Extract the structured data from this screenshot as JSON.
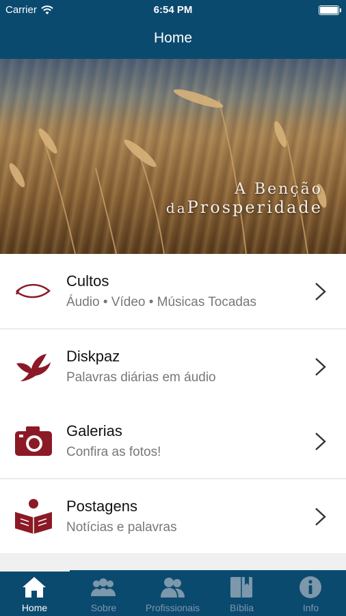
{
  "status_bar": {
    "carrier": "Carrier",
    "time": "6:54 PM"
  },
  "navbar": {
    "title": "Home"
  },
  "banner": {
    "line1": "A Benção",
    "line2_prefix": "da",
    "line2_main": "Prosperidade"
  },
  "menu": [
    {
      "title": "Cultos",
      "subtitle": "Áudio • Vídeo • Músicas Tocadas",
      "icon": "fish-icon"
    },
    {
      "title": "Diskpaz",
      "subtitle": "Palavras diárias em áudio",
      "icon": "dove-icon"
    },
    {
      "title": "Galerias",
      "subtitle": "Confira as fotos!",
      "icon": "camera-icon"
    },
    {
      "title": "Postagens",
      "subtitle": "Notícias e palavras",
      "icon": "reader-icon"
    }
  ],
  "tabs": [
    {
      "label": "Home",
      "icon": "home-icon",
      "active": true
    },
    {
      "label": "Sobre",
      "icon": "group-icon",
      "active": false
    },
    {
      "label": "Profissionais",
      "icon": "people-icon",
      "active": false
    },
    {
      "label": "Bíblia",
      "icon": "book-icon",
      "active": false
    },
    {
      "label": "Info",
      "icon": "info-icon",
      "active": false
    }
  ],
  "colors": {
    "bar": "#0b4a6f",
    "accent": "#8b1a26",
    "tab_inactive": "#7d97ab"
  }
}
